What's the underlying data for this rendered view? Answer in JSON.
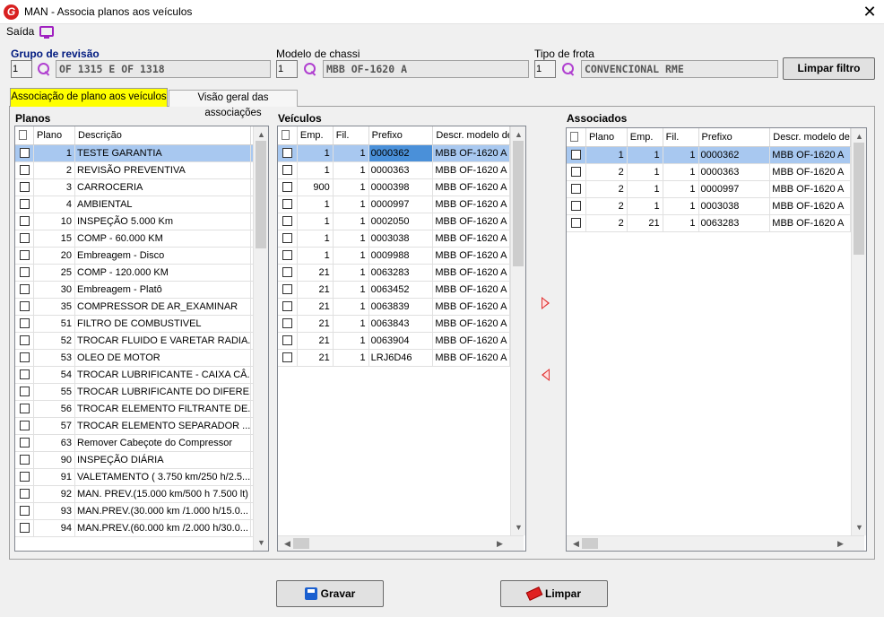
{
  "window": {
    "title": "MAN - Associa planos aos veículos",
    "close": "✕",
    "logo": "G"
  },
  "menu": {
    "saida": "Saída"
  },
  "filters": {
    "grupo": {
      "label": "Grupo de revisão",
      "code": "1",
      "value": "OF 1315 E OF 1318"
    },
    "modelo": {
      "label": "Modelo de chassi",
      "code": "1",
      "value": "MBB OF-1620 A"
    },
    "frota": {
      "label": "Tipo de frota",
      "code": "1",
      "value": "CONVENCIONAL RME"
    },
    "limpar_filtro": "Limpar filtro"
  },
  "tabs": {
    "tab1": "Associação de plano aos veículos",
    "tab2": "Visão geral das associações"
  },
  "planos": {
    "title": "Planos",
    "headers": [
      "",
      "Plano",
      "Descrição"
    ],
    "rows": [
      [
        "1",
        "TESTE GARANTIA"
      ],
      [
        "2",
        "REVISÃO PREVENTIVA"
      ],
      [
        "3",
        "CARROCERIA"
      ],
      [
        "4",
        "AMBIENTAL"
      ],
      [
        "10",
        "INSPEÇÃO 5.000 Km"
      ],
      [
        "15",
        "COMP -  60.000 KM"
      ],
      [
        "20",
        "Embreagem - Disco"
      ],
      [
        "25",
        "COMP - 120.000 KM"
      ],
      [
        "30",
        "Embreagem - Platô"
      ],
      [
        "35",
        "COMPRESSOR DE AR_EXAMINAR"
      ],
      [
        "51",
        "FILTRO DE COMBUSTIVEL"
      ],
      [
        "52",
        "TROCAR FLUIDO E VARETAR RADIA..."
      ],
      [
        "53",
        "OLEO DE MOTOR"
      ],
      [
        "54",
        "TROCAR LUBRIFICANTE - CAIXA CÂ..."
      ],
      [
        "55",
        "TROCAR LUBRIFICANTE DO DIFERE..."
      ],
      [
        "56",
        "TROCAR ELEMENTO FILTRANTE DE..."
      ],
      [
        "57",
        "TROCAR ELEMENTO SEPARADOR ..."
      ],
      [
        "63",
        "Remover Cabeçote do Compressor"
      ],
      [
        "90",
        "INSPEÇÃO DIÁRIA"
      ],
      [
        "91",
        "VALETAMENTO ( 3.750 km/250 h/2.5..."
      ],
      [
        "92",
        "MAN. PREV.(15.000 km/500 h 7.500 lt)"
      ],
      [
        "93",
        "MAN.PREV.(30.000 km /1.000 h/15.0..."
      ],
      [
        "94",
        "MAN.PREV.(60.000 km /2.000 h/30.0..."
      ]
    ]
  },
  "veiculos": {
    "title": "Veículos",
    "headers": [
      "",
      "Emp.",
      "Fil.",
      "Prefixo",
      "Descr. modelo de"
    ],
    "rows": [
      [
        "1",
        "1",
        "0000362",
        "MBB OF-1620 A"
      ],
      [
        "1",
        "1",
        "0000363",
        "MBB OF-1620 A"
      ],
      [
        "900",
        "1",
        "0000398",
        "MBB OF-1620 A"
      ],
      [
        "1",
        "1",
        "0000997",
        "MBB OF-1620 A"
      ],
      [
        "1",
        "1",
        "0002050",
        "MBB OF-1620 A"
      ],
      [
        "1",
        "1",
        "0003038",
        "MBB OF-1620 A"
      ],
      [
        "1",
        "1",
        "0009988",
        "MBB OF-1620 A"
      ],
      [
        "21",
        "1",
        "0063283",
        "MBB OF-1620 A"
      ],
      [
        "21",
        "1",
        "0063452",
        "MBB OF-1620 A"
      ],
      [
        "21",
        "1",
        "0063839",
        "MBB OF-1620 A"
      ],
      [
        "21",
        "1",
        "0063843",
        "MBB OF-1620 A"
      ],
      [
        "21",
        "1",
        "0063904",
        "MBB OF-1620 A"
      ],
      [
        "21",
        "1",
        "LRJ6D46",
        "MBB OF-1620 A"
      ]
    ]
  },
  "associados": {
    "title": "Associados",
    "headers": [
      "",
      "Plano",
      "Emp.",
      "Fil.",
      "Prefixo",
      "Descr. modelo de"
    ],
    "rows": [
      [
        "1",
        "1",
        "1",
        "0000362",
        "MBB OF-1620 A"
      ],
      [
        "2",
        "1",
        "1",
        "0000363",
        "MBB OF-1620 A"
      ],
      [
        "2",
        "1",
        "1",
        "0000997",
        "MBB OF-1620 A"
      ],
      [
        "2",
        "1",
        "1",
        "0003038",
        "MBB OF-1620 A"
      ],
      [
        "2",
        "21",
        "1",
        "0063283",
        "MBB OF-1620 A"
      ]
    ]
  },
  "buttons": {
    "gravar": "Gravar",
    "limpar": "Limpar"
  },
  "colors": {
    "selected_row": "#a8c8f0",
    "tab_active": "#ffff00",
    "arrow": "#e03030"
  }
}
